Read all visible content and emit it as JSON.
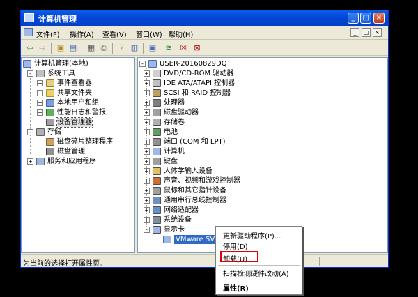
{
  "window": {
    "title": "计算机管理",
    "buttons": {
      "minimize": "_",
      "maximize": "□",
      "close": "×"
    }
  },
  "menubar": {
    "items": [
      "文件(F)",
      "操作(A)",
      "查看(V)",
      "窗口(W)",
      "帮助(H)"
    ],
    "mdi_buttons": [
      "_",
      "□",
      "×"
    ]
  },
  "toolbar": {
    "buttons": [
      "back-icon",
      "forward-icon",
      "up-icon",
      "show-tree-icon",
      "properties-icon",
      "print-icon",
      "help-icon",
      "export-icon",
      "refresh-icon",
      "scan-icon",
      "uninstall-icon",
      "disable-icon"
    ]
  },
  "left_tree": {
    "root": "计算机管理(本地)",
    "items": [
      {
        "label": "系统工具",
        "indent": 1,
        "expander": "-"
      },
      {
        "label": "事件查看器",
        "indent": 2,
        "expander": "+"
      },
      {
        "label": "共享文件夹",
        "indent": 2,
        "expander": "+"
      },
      {
        "label": "本地用户和组",
        "indent": 2,
        "expander": "+"
      },
      {
        "label": "性能日志和警报",
        "indent": 2,
        "expander": "+"
      },
      {
        "label": "设备管理器",
        "indent": 2,
        "expander": "",
        "selected": true
      },
      {
        "label": "存储",
        "indent": 1,
        "expander": "-"
      },
      {
        "label": "磁盘碎片整理程序",
        "indent": 2,
        "expander": ""
      },
      {
        "label": "磁盘管理",
        "indent": 2,
        "expander": ""
      },
      {
        "label": "服务和应用程序",
        "indent": 1,
        "expander": "+"
      }
    ]
  },
  "right_tree": {
    "root": "USER-20160829DQ",
    "items": [
      {
        "label": "DVD/CD-ROM 驱动器",
        "expander": "+"
      },
      {
        "label": "IDE ATA/ATAPI 控制器",
        "expander": "+"
      },
      {
        "label": "SCSI 和 RAID 控制器",
        "expander": "+"
      },
      {
        "label": "处理器",
        "expander": "+"
      },
      {
        "label": "磁盘驱动器",
        "expander": "+"
      },
      {
        "label": "存储卷",
        "expander": "+"
      },
      {
        "label": "电池",
        "expander": "+"
      },
      {
        "label": "端口 (COM 和 LPT)",
        "expander": "+"
      },
      {
        "label": "计算机",
        "expander": "+"
      },
      {
        "label": "键盘",
        "expander": "+"
      },
      {
        "label": "人体学输入设备",
        "expander": "+"
      },
      {
        "label": "声音、视频和游戏控制器",
        "expander": "+"
      },
      {
        "label": "鼠标和其它指针设备",
        "expander": "+"
      },
      {
        "label": "通用串行总线控制器",
        "expander": "+"
      },
      {
        "label": "网络适配器",
        "expander": "+"
      },
      {
        "label": "系统设备",
        "expander": "+"
      },
      {
        "label": "显示卡",
        "expander": "-"
      }
    ],
    "child": "VMware SVGA II"
  },
  "context_menu": {
    "items": [
      "更新驱动程序(P)...",
      "停用(D)",
      "卸载(U)",
      "扫描检测硬件改动(A)",
      "属性(R)"
    ],
    "highlighted": "卸载(U)",
    "highlight_color": "#e00000"
  },
  "statusbar": {
    "text": "为当前的选择打开属性页。"
  },
  "colors": {
    "titlebar": "#0346d9",
    "window_bg": "#ece9d8",
    "selection_box": "#e00000"
  }
}
